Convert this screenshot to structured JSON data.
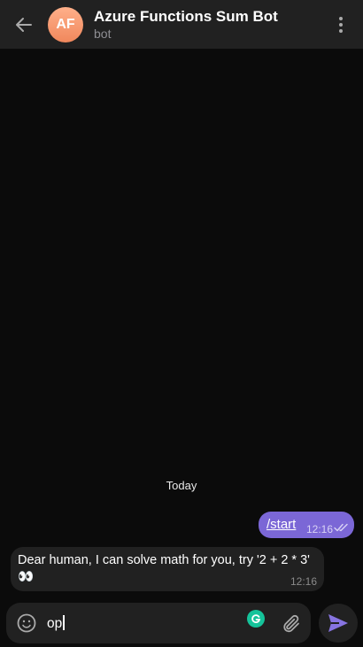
{
  "header": {
    "back_icon": "arrow-left-icon",
    "avatar_initials": "AF",
    "title": "Azure Functions Sum Bot",
    "subtitle": "bot",
    "menu_icon": "more-vertical-icon"
  },
  "messages": {
    "date_label": "Today",
    "outgoing": {
      "text": "/start",
      "time": "12:16",
      "status_icon": "double-check-icon"
    },
    "incoming": {
      "text": "Dear human, I can solve math for you, try '2 + 2 * 3' 👀",
      "time": "12:16"
    }
  },
  "composer": {
    "input_value": "op",
    "emoji_icon": "emoji-icon",
    "grammarly_icon": "grammarly-icon",
    "attach_icon": "paperclip-icon",
    "send_icon": "send-icon"
  },
  "colors": {
    "accent": "#7b67d6",
    "background": "#0b0b0b",
    "panel": "#212121",
    "avatar": "#f0885c"
  }
}
